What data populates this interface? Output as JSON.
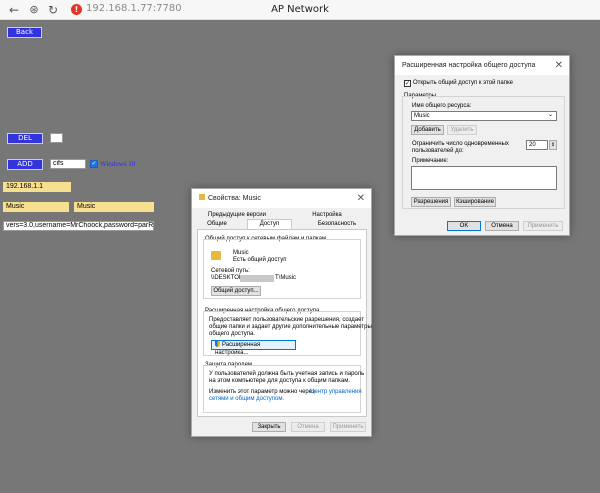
{
  "browser": {
    "back_icon": "←",
    "forward_icon": "→",
    "reload_icon": "↻",
    "url": "192.168.1.77:7780",
    "title": "AP Network"
  },
  "page": {
    "back_label": "Back",
    "del_label": "DEL",
    "del_value": "",
    "add_label": "ADD",
    "add_value": "cifs",
    "windows_label": "Windows 10",
    "ip": "192.168.1.1",
    "share_name_1": "Music",
    "share_name_2": "Music",
    "options": "vers=3.0,username=MrChoock,password=parR"
  },
  "props_dialog": {
    "title": "Свойства: Music",
    "tabs_row1": [
      "Предыдущие версии",
      "Настройка"
    ],
    "tabs_row2": [
      "Общие",
      "Доступ",
      "Безопасность"
    ],
    "net_share_group": "Общий доступ к сетевым файлам и папкам",
    "folder_name": "Music",
    "folder_status": "Есть общий доступ",
    "net_path_label": "Сетевой путь:",
    "net_path_prefix": "\\\\DESKTOI",
    "net_path_suffix": "T\\Music",
    "share_button": "Общий доступ...",
    "adv_group": "Расширенная настройка общего доступа",
    "adv_text": [
      "Предоставляет пользовательские разрешения, создает",
      "общие папки и задает другие дополнительные параметры",
      "общего доступа."
    ],
    "adv_button": "Расширенная настройка...",
    "pwd_group": "Защита паролем",
    "pwd_text": [
      "У пользователей должна быть учетная запись и пароль",
      "на этом компьютере для доступа к общим папкам."
    ],
    "change_text": "Изменить этот параметр можно через",
    "change_link": [
      "Центр управления",
      "сетями и общим доступом."
    ],
    "btn_close": "Закрыть",
    "btn_cancel": "Отмена",
    "btn_apply": "Применить"
  },
  "adv_dialog": {
    "title": "Расширенная настройка общего доступа",
    "share_checkbox": "Открыть общий доступ к этой папке",
    "params_group": "Параметры",
    "share_name_label": "Имя общего ресурса:",
    "share_name_value": "Music",
    "add_button": "Добавить",
    "remove_button": "Удалить",
    "limit_label": [
      "Ограничить число одновременных",
      "пользователей до:"
    ],
    "limit_value": "20",
    "note_label": "Примечание:",
    "note_value": "",
    "perm_button": "Разрешения",
    "cache_button": "Кэширование",
    "ok_button": "OK",
    "cancel_button": "Отмена",
    "apply_button": "Применить"
  },
  "icons": {
    "close": "✕",
    "check": "✓",
    "chevron": "⌄",
    "shield": "shield-icon",
    "folder": "folder-icon",
    "warning": "warning-icon"
  },
  "colors": {
    "bg": "#777777",
    "button": "#3434dc",
    "field_yellow": "#f6df8f"
  }
}
